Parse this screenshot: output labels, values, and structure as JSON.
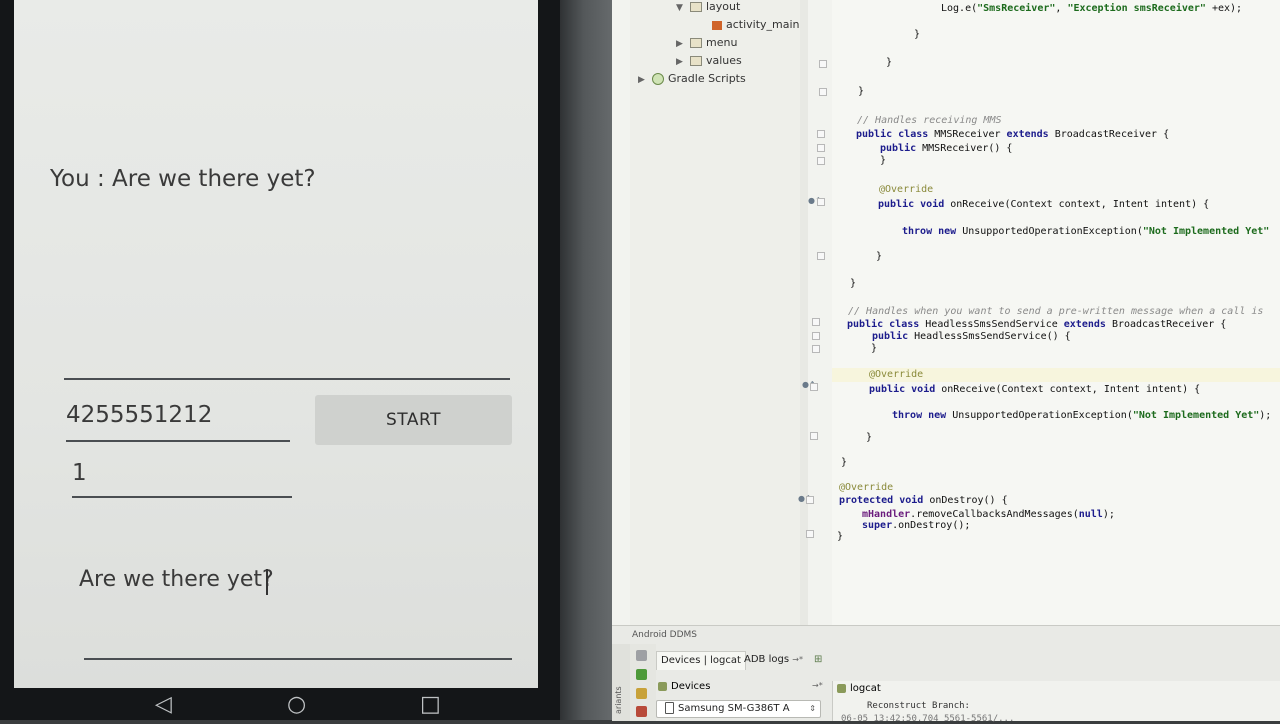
{
  "phone": {
    "chat_line": "You : Are we there yet?",
    "phone_number": "4255551212",
    "start_button": "START",
    "count": "1",
    "message": "Are we there yet?",
    "nav": {
      "back": "◁",
      "home": "○",
      "recents": "□"
    }
  },
  "project_tree": {
    "items": [
      {
        "label": "layout",
        "icon": "folder-icon"
      },
      {
        "label": "activity_main.x",
        "icon": "xml-file-icon"
      },
      {
        "label": "menu",
        "icon": "folder-icon"
      },
      {
        "label": "values",
        "icon": "folder-icon"
      },
      {
        "label": "Gradle Scripts",
        "icon": "gradle-icon"
      }
    ]
  },
  "code": {
    "log_call_prefix": "Log.e(",
    "log_tag": "\"SmsReceiver\"",
    "log_msg": "\"Exception smsReceiver\"",
    "log_call_suffix": " +ex);",
    "brace_close": "}",
    "comment_mms": "// Handles receiving MMS",
    "kw_public": "public",
    "kw_class": "class",
    "kw_extends": "extends",
    "kw_void": "void",
    "kw_throw": "throw",
    "kw_new": "new",
    "kw_protected": "protected",
    "kw_super": "super",
    "mms_class_name": " MMSReceiver ",
    "broadcast_receiver": " BroadcastReceiver {",
    "mms_ctor": " MMSReceiver() {",
    "override": "@Override",
    "on_receive_sig": " onReceive(Context context, Intent intent) {",
    "unsupported_call": " UnsupportedOperationException(",
    "not_impl_1": "\"Not Implemented Yet\"",
    "not_impl_2": "\"Not Implemented Yet\"",
    "not_impl_end": ");",
    "comment_headless": "// Handles when you want to send a pre-written message when a call is",
    "headless_class_name": " HeadlessSmsSendService ",
    "headless_ctor": " HeadlessSmsSendService() {",
    "on_destroy_sig": " onDestroy() {",
    "handler_field": "mHandler",
    "remove_callbacks": ".removeCallbacksAndMessages(",
    "null_kw": "null",
    "remove_callbacks_end": ");",
    "super_on_destroy": ".onDestroy();"
  },
  "ddms": {
    "panel_title": "Android DDMS",
    "side_label": "ariants",
    "tab_devices_logcat": "Devices | logcat",
    "tab_adb_logs": "ADB logs",
    "tab_adb_arrow": "→*",
    "devices_label": "Devices",
    "devices_arrow": "→*",
    "logcat_label": "logcat",
    "device_name": "Samsung SM-G386T A",
    "log_line_1": "Reconstruct Branch:",
    "log_line_2": "06-05 13:42:50.704   5561-5561/..."
  }
}
